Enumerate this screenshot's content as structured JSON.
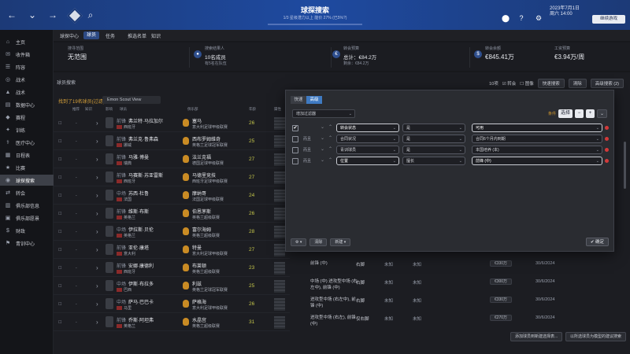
{
  "header": {
    "title": "球探搜索",
    "subtitle": "1/3 星级潜力以上    能价 27% (已5%?)",
    "date_line1": "2023年7月1日",
    "date_line2": "周六 14:00",
    "continue_label": "继续游戏"
  },
  "subnav": [
    "球探中心",
    "球员",
    "任务",
    "推选名单",
    "知识"
  ],
  "sidebar": [
    {
      "icon": "⌂",
      "label": "主页"
    },
    {
      "icon": "✉",
      "label": "收件箱"
    },
    {
      "icon": "☰",
      "label": "阵容"
    },
    {
      "icon": "◎",
      "label": "战术"
    },
    {
      "icon": "▲",
      "label": "战术"
    },
    {
      "icon": "▤",
      "label": "数据中心"
    },
    {
      "icon": "◆",
      "label": "赛程"
    },
    {
      "icon": "✦",
      "label": "训练"
    },
    {
      "icon": "⚕",
      "label": "医疗中心"
    },
    {
      "icon": "▦",
      "label": "日程表"
    },
    {
      "icon": "★",
      "label": "比赛"
    },
    {
      "icon": "◉",
      "label": "球探搜索"
    },
    {
      "icon": "⇄",
      "label": "转会"
    },
    {
      "icon": "▥",
      "label": "俱乐部信息"
    },
    {
      "icon": "▣",
      "label": "俱乐部愿景"
    },
    {
      "icon": "$",
      "label": "财政"
    },
    {
      "icon": "⚑",
      "label": "青训中心"
    }
  ],
  "cards": [
    {
      "label": "搜寻范围",
      "value": "无范围",
      "sub": ""
    },
    {
      "label": "搜索结果人",
      "value": "10名成员",
      "sub": "有5名在队伍"
    },
    {
      "label": "转会预算",
      "value": "总计：€84.2万",
      "sub": "剩余：€84.2万"
    },
    {
      "label": "转会余额",
      "value": "€845.41万",
      "sub": ""
    },
    {
      "label": "工资预算",
      "value": "€3.94万/周",
      "sub": ""
    }
  ],
  "main": {
    "row_heading": "球员搜索",
    "list_title": "找到了19名球员(过滤)",
    "scout_view": "Emon Scout View",
    "controls": {
      "count": "10项",
      "transfer": "转会",
      "view": "图像",
      "quick_search": "快速搜索",
      "clear": "清除",
      "advanced_search": "高级搜索 (2)"
    },
    "columns": [
      "推荐",
      "知识",
      "影响",
      "球员",
      "俱乐部",
      "年龄",
      "属性"
    ]
  },
  "players": [
    {
      "name": "弗兰特·马拉加尔",
      "pos": "前锋",
      "nation": "西班牙",
      "club": "塞马",
      "league": "意大利足球甲级联赛",
      "age": "26"
    },
    {
      "name": "弗兰克·鲁弗森",
      "pos": "前锋",
      "nation": "挪威",
      "club": "西布罗姆维奇",
      "league": "英格兰足球冠军联赛",
      "age": "25"
    },
    {
      "name": "马雅·博曼",
      "pos": "前锋",
      "nation": "瑞典",
      "club": "法兰克福",
      "league": "德国足球甲级联赛",
      "age": "27"
    },
    {
      "name": "马赛斯·苏亚雷斯",
      "pos": "前锋",
      "nation": "西班牙",
      "club": "马德里竞技",
      "league": "西班牙足球甲级联赛",
      "age": "27"
    },
    {
      "name": "苏西·杜鲁",
      "pos": "中场",
      "nation": "法国",
      "club": "摩纳哥",
      "league": "法国足球甲级联赛",
      "age": "24"
    },
    {
      "name": "维斯·布斯",
      "pos": "前锋",
      "nation": "英格兰",
      "club": "伯恩茅斯",
      "league": "英格兰超级联赛",
      "age": "26"
    },
    {
      "name": "伊拉斯·贝伦",
      "pos": "中场",
      "nation": "英格兰",
      "club": "富尔海姆",
      "league": "英格兰超级联赛",
      "age": "28"
    },
    {
      "name": "亚伦·康塔",
      "pos": "前锋",
      "nation": "意大利",
      "club": "特曼",
      "league": "意大利足球甲级联赛",
      "age": "27"
    },
    {
      "name": "安娜·康德利",
      "pos": "前锋",
      "nation": "西班牙",
      "club": "布莱顿",
      "league": "英格兰超级联赛",
      "age": "23"
    },
    {
      "name": "伊斯·布拉多",
      "pos": "中场",
      "nation": "巴西",
      "club": "利兹",
      "league": "英格兰足球冠军联赛",
      "age": "25"
    },
    {
      "name": "萨马·巴巴卡",
      "pos": "中场",
      "nation": "马里",
      "club": "萨格海",
      "league": "意大利足球甲级联赛",
      "age": "26"
    },
    {
      "name": "乔斯·阿坦弗",
      "pos": "前锋",
      "nation": "英格兰",
      "club": "水晶宫",
      "league": "英格兰超级联赛",
      "age": "31"
    }
  ],
  "extra_rows": [
    {
      "position": "前锋 (中)",
      "foot": "右脚",
      "val1": "未知",
      "val2": "未知",
      "fee": "€330万",
      "date": "30/6/2024"
    },
    {
      "position": "中场 (中) 进攻型中场 (右左中), 前锋 (中)",
      "foot": "右脚",
      "val1": "未知",
      "val2": "未知",
      "fee": "€300万",
      "date": "30/6/2024"
    },
    {
      "position": "进攻型中场 (右左中), 前锋 (中)",
      "foot": "右脚",
      "val1": "未知",
      "val2": "未知",
      "fee": "€330万",
      "date": "30/6/2024"
    },
    {
      "position": "进攻型中场 (右左), 前锋 (中)",
      "foot": "仅右脚",
      "val1": "未知",
      "val2": "未知",
      "fee": "€270万",
      "date": "30/6/2024"
    }
  ],
  "modal": {
    "tabs": [
      "快速",
      "高级"
    ],
    "preset": "增加过滤器",
    "logic_label": "条件",
    "choose": "选择",
    "rows": [
      {
        "checked": true,
        "mode": "",
        "field": "转会状态",
        "op": "是",
        "value": "可用"
      },
      {
        "checked": false,
        "mode": "而且",
        "field": "合同状况",
        "op": "是",
        "value": "合同6个月内到期"
      },
      {
        "checked": false,
        "mode": "而且",
        "field": "青训球员",
        "op": "是",
        "value": "本国培养 (本)"
      },
      {
        "checked": false,
        "mode": "而且",
        "field": "位置",
        "op": "擅长",
        "value": "前锋 (中)"
      }
    ],
    "footer": {
      "settings": "⚙ ▾",
      "clear": "清除",
      "more": "新建 ▾",
      "confirm": "✔ 确定"
    }
  },
  "bottom_buttons": [
    "添加球员到新建选择表...",
    "以所选球员为模型的建议搜索"
  ]
}
